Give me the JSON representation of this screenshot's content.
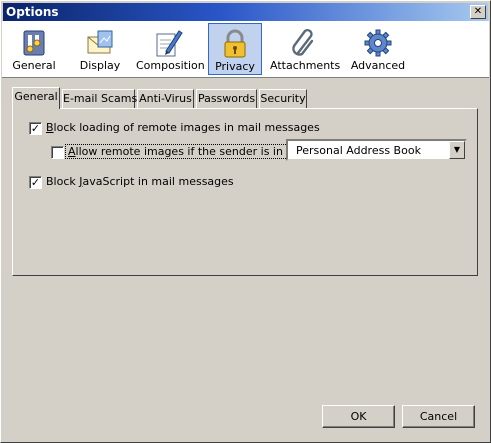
{
  "window": {
    "title": "Options",
    "close_label": "✕"
  },
  "toolbar": {
    "items": [
      {
        "label": "General",
        "icon": "general-icon"
      },
      {
        "label": "Display",
        "icon": "display-icon"
      },
      {
        "label": "Composition",
        "icon": "composition-icon"
      },
      {
        "label": "Privacy",
        "icon": "lock-icon",
        "selected": true
      },
      {
        "label": "Attachments",
        "icon": "paperclip-icon"
      },
      {
        "label": "Advanced",
        "icon": "gear-icon"
      }
    ]
  },
  "tabs": [
    {
      "label": "General",
      "active": true
    },
    {
      "label": "E-mail Scams"
    },
    {
      "label": "Anti-Virus"
    },
    {
      "label": "Passwords"
    },
    {
      "label": "Security"
    }
  ],
  "general": {
    "block_images": {
      "prefix": "",
      "key": "B",
      "rest": "lock loading of remote images in mail messages",
      "checked": true
    },
    "allow_images": {
      "prefix": "",
      "key": "A",
      "rest": "llow remote images if the sender is in my:",
      "checked": false
    },
    "address_book": {
      "value": "Personal Address Book"
    },
    "block_js": {
      "prefix": "Block ",
      "key": "J",
      "rest": "avaScript in mail messages",
      "checked": true
    }
  },
  "buttons": {
    "ok": "OK",
    "cancel": "Cancel"
  },
  "colors": {
    "titlebar_start": "#0a246a",
    "titlebar_end": "#a6caf0",
    "selected_toolbar": "#c1d2ee",
    "face": "#d4d0c8"
  }
}
